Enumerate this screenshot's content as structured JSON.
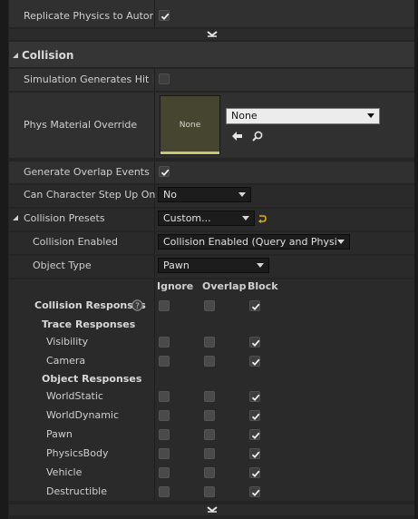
{
  "top": {
    "replicate_label": "Replicate Physics to Autonom",
    "replicate_checked": true
  },
  "section": {
    "title": "Collision"
  },
  "rows": {
    "sim_hit_label": "Simulation Generates Hit Eve",
    "sim_hit_checked": false,
    "phys_mat_label": "Phys Material Override",
    "phys_mat_thumb": "None",
    "phys_mat_value": "None",
    "overlap_label": "Generate Overlap Events",
    "overlap_checked": true,
    "step_up_label": "Can Character Step Up On",
    "step_up_value": "No",
    "presets_label": "Collision Presets",
    "presets_value": "Custom...",
    "enabled_label": "Collision Enabled",
    "enabled_value": "Collision Enabled (Query and Physics)",
    "object_type_label": "Object Type",
    "object_type_value": "Pawn"
  },
  "responses": {
    "columns": [
      "Ignore",
      "Overlap",
      "Block"
    ],
    "title": "Collision Responses",
    "help_icon": "question-circle-icon",
    "trace_title": "Trace Responses",
    "object_title": "Object Responses",
    "all_row": {
      "ignore": false,
      "overlap": false,
      "block": true
    },
    "trace": [
      {
        "name": "Visibility",
        "ignore": false,
        "overlap": false,
        "block": true
      },
      {
        "name": "Camera",
        "ignore": false,
        "overlap": false,
        "block": true
      }
    ],
    "objects": [
      {
        "name": "WorldStatic",
        "ignore": false,
        "overlap": false,
        "block": true
      },
      {
        "name": "WorldDynamic",
        "ignore": false,
        "overlap": false,
        "block": true
      },
      {
        "name": "Pawn",
        "ignore": false,
        "overlap": false,
        "block": true
      },
      {
        "name": "PhysicsBody",
        "ignore": false,
        "overlap": false,
        "block": true
      },
      {
        "name": "Vehicle",
        "ignore": false,
        "overlap": false,
        "block": true
      },
      {
        "name": "Destructible",
        "ignore": false,
        "overlap": false,
        "block": true
      }
    ]
  },
  "icons": {
    "use_selected": "arrow-left-icon",
    "browse": "search-icon",
    "reset": "reset-to-default-icon",
    "expand": "chevron-down-icon",
    "collapse": "triangle-down-icon"
  },
  "colors": {
    "panel": "#242424",
    "row": "#303030",
    "combo": "#1c1c1c",
    "reset_arrow": "#e0b000",
    "thumb_bar": "#c8c86a"
  }
}
